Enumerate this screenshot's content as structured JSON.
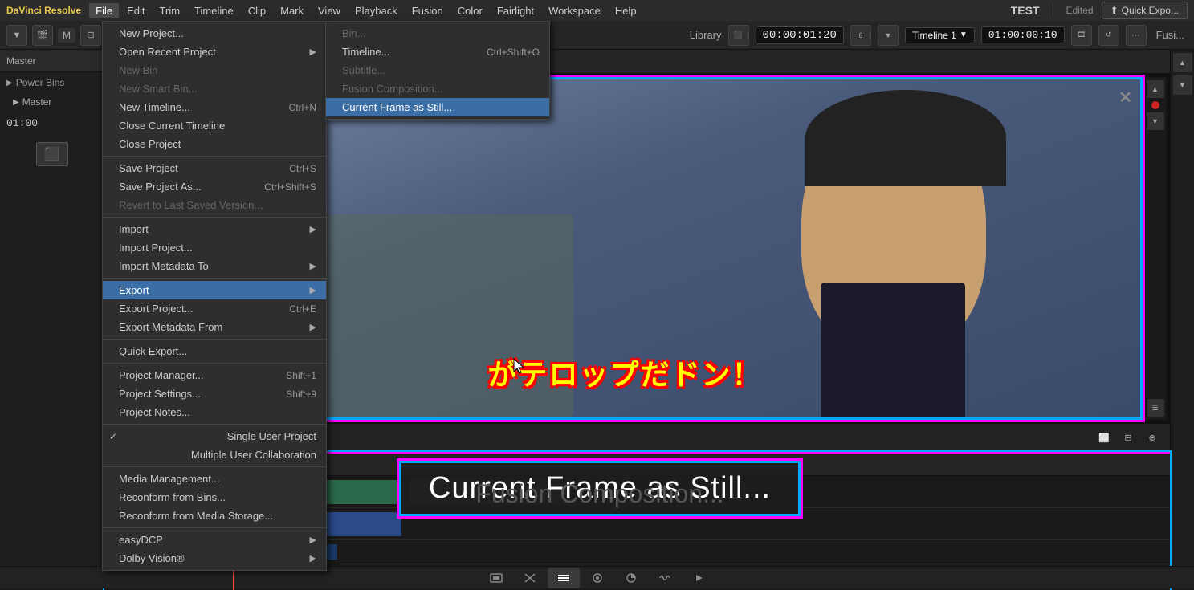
{
  "app": {
    "name": "DaVinci Resolve",
    "name_color": "#e8c84a"
  },
  "menu_bar": {
    "items": [
      {
        "id": "file",
        "label": "File",
        "active": true
      },
      {
        "id": "edit",
        "label": "Edit"
      },
      {
        "id": "trim",
        "label": "Trim"
      },
      {
        "id": "timeline",
        "label": "Timeline"
      },
      {
        "id": "clip",
        "label": "Clip"
      },
      {
        "id": "mark",
        "label": "Mark"
      },
      {
        "id": "view",
        "label": "View"
      },
      {
        "id": "playback",
        "label": "Playback"
      },
      {
        "id": "fusion",
        "label": "Fusion"
      },
      {
        "id": "color",
        "label": "Color"
      },
      {
        "id": "fairlight",
        "label": "Fairlight"
      },
      {
        "id": "workspace",
        "label": "Workspace"
      },
      {
        "id": "help",
        "label": "Help"
      }
    ]
  },
  "toolbar": {
    "timecode": "00:00:01:20",
    "timeline_name": "Timeline 1",
    "timeline_timecode": "01:00:00:10",
    "project_name": "TEST",
    "edited_label": "Edited",
    "quick_export": "Quick Expo..."
  },
  "preview": {
    "japanese_text": "がテロップだドン！",
    "library_label": "Library"
  },
  "file_menu": {
    "sections": [
      {
        "items": [
          {
            "label": "New Project...",
            "shortcut": "",
            "has_arrow": false,
            "disabled": false
          },
          {
            "label": "Open Recent Project",
            "shortcut": "",
            "has_arrow": true,
            "disabled": false
          },
          {
            "label": "New Bin",
            "shortcut": "",
            "has_arrow": false,
            "disabled": true
          },
          {
            "label": "New Smart Bin...",
            "shortcut": "",
            "has_arrow": false,
            "disabled": true
          },
          {
            "label": "New Timeline...",
            "shortcut": "Ctrl+N",
            "has_arrow": false,
            "disabled": false
          },
          {
            "label": "Close Current Timeline",
            "shortcut": "",
            "has_arrow": false,
            "disabled": false
          },
          {
            "label": "Close Project",
            "shortcut": "",
            "has_arrow": false,
            "disabled": false
          }
        ]
      },
      {
        "items": [
          {
            "label": "Save Project",
            "shortcut": "Ctrl+S",
            "has_arrow": false,
            "disabled": false
          },
          {
            "label": "Save Project As...",
            "shortcut": "Ctrl+Shift+S",
            "has_arrow": false,
            "disabled": false
          },
          {
            "label": "Revert to Last Saved Version...",
            "shortcut": "",
            "has_arrow": false,
            "disabled": true
          }
        ]
      },
      {
        "items": [
          {
            "label": "Import",
            "shortcut": "",
            "has_arrow": true,
            "disabled": false
          },
          {
            "label": "Import Project...",
            "shortcut": "",
            "has_arrow": false,
            "disabled": false
          },
          {
            "label": "Import Metadata To",
            "shortcut": "",
            "has_arrow": true,
            "disabled": false
          }
        ]
      },
      {
        "items": [
          {
            "label": "Export",
            "shortcut": "",
            "has_arrow": true,
            "disabled": false,
            "highlighted": true
          },
          {
            "label": "Export Project...",
            "shortcut": "Ctrl+E",
            "has_arrow": false,
            "disabled": false
          },
          {
            "label": "Export Metadata From",
            "shortcut": "",
            "has_arrow": true,
            "disabled": false
          }
        ]
      },
      {
        "items": [
          {
            "label": "Quick Export...",
            "shortcut": "",
            "has_arrow": false,
            "disabled": false
          }
        ]
      },
      {
        "items": [
          {
            "label": "Project Manager...",
            "shortcut": "Shift+1",
            "has_arrow": false,
            "disabled": false
          },
          {
            "label": "Project Settings...",
            "shortcut": "Shift+9",
            "has_arrow": false,
            "disabled": false
          },
          {
            "label": "Project Notes...",
            "shortcut": "",
            "has_arrow": false,
            "disabled": false
          }
        ]
      },
      {
        "items": [
          {
            "label": "Single User Project",
            "shortcut": "",
            "has_arrow": false,
            "disabled": false,
            "checked": true
          },
          {
            "label": "Multiple User Collaboration",
            "shortcut": "",
            "has_arrow": false,
            "disabled": false
          }
        ]
      },
      {
        "items": [
          {
            "label": "Media Management...",
            "shortcut": "",
            "has_arrow": false,
            "disabled": false
          },
          {
            "label": "Reconform from Bins...",
            "shortcut": "",
            "has_arrow": false,
            "disabled": false
          },
          {
            "label": "Reconform from Media Storage...",
            "shortcut": "",
            "has_arrow": false,
            "disabled": false
          }
        ]
      },
      {
        "items": [
          {
            "label": "easyDCP",
            "shortcut": "",
            "has_arrow": true,
            "disabled": false
          },
          {
            "label": "Dolby Vision®",
            "shortcut": "",
            "has_arrow": true,
            "disabled": false
          }
        ]
      }
    ]
  },
  "export_submenu": {
    "items": [
      {
        "label": "Bin...",
        "shortcut": "",
        "disabled": true
      },
      {
        "label": "Timeline...",
        "shortcut": "Ctrl+Shift+O",
        "disabled": false
      },
      {
        "label": "Subtitle...",
        "shortcut": "",
        "disabled": true
      },
      {
        "label": "Fusion Composition...",
        "shortcut": "",
        "disabled": true
      },
      {
        "label": "Current Frame as Still...",
        "shortcut": "",
        "disabled": false,
        "highlighted": true
      }
    ]
  },
  "current_frame_preview": {
    "text": "Current Frame as Still..."
  },
  "left_panel": {
    "master_label": "Master",
    "power_bins_label": "Power Bins",
    "master_tree_label": "Master",
    "timecode": "01:00"
  },
  "workspace_icons": [
    {
      "id": "media",
      "label": "⬛",
      "title": "Media"
    },
    {
      "id": "cut",
      "label": "✂",
      "title": "Cut"
    },
    {
      "id": "edit",
      "label": "▤",
      "title": "Edit",
      "active": true
    },
    {
      "id": "fusion",
      "label": "◈",
      "title": "Fusion"
    },
    {
      "id": "color",
      "label": "◑",
      "title": "Color"
    },
    {
      "id": "fairlight",
      "label": "♫",
      "title": "Fairlight"
    },
    {
      "id": "deliver",
      "label": "▶",
      "title": "Deliver"
    }
  ]
}
